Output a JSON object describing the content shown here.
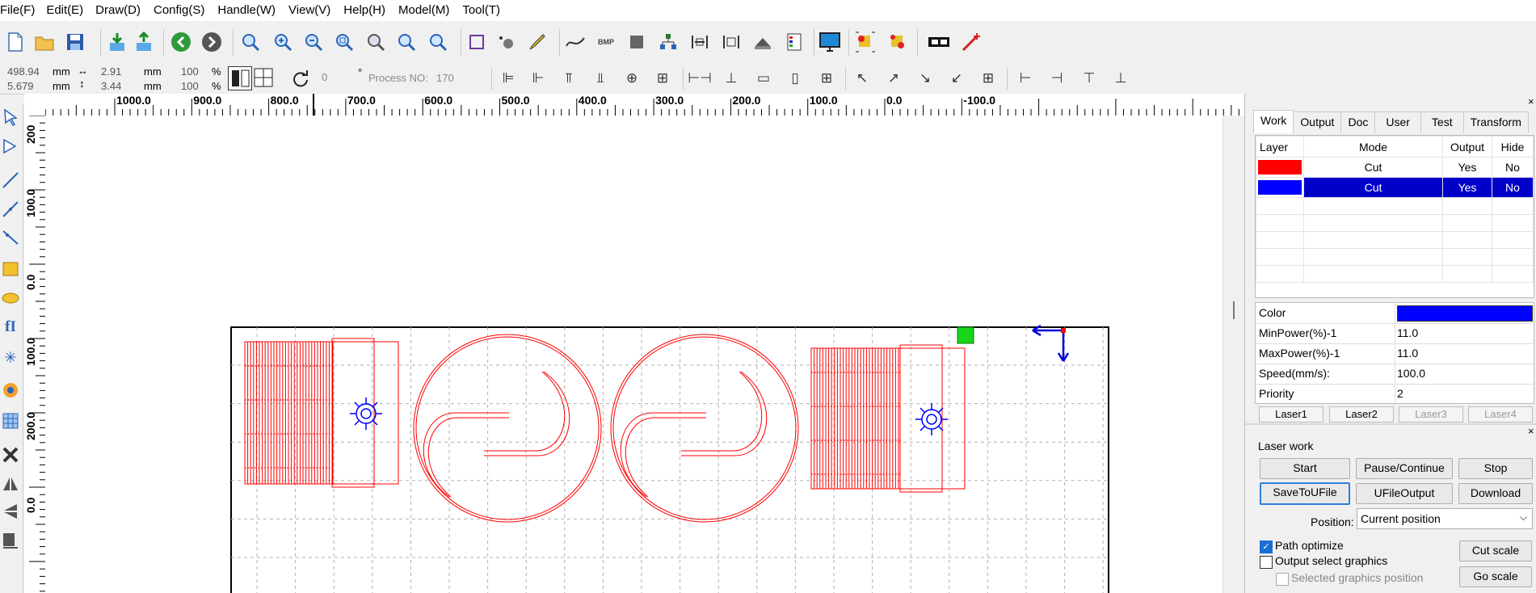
{
  "menu": [
    "File(F)",
    "Edit(E)",
    "Draw(D)",
    "Config(S)",
    "Handle(W)",
    "View(V)",
    "Help(H)",
    "Model(M)",
    "Tool(T)"
  ],
  "toolbar2": {
    "x_value": "498.94",
    "y_value": "5.679",
    "x_unit": "mm",
    "y_unit": "mm",
    "w_value": "2.91",
    "h_value": "3.44",
    "w_unit": "mm",
    "h_unit": "mm",
    "scale_x": "100",
    "scale_y": "100",
    "percent": "%",
    "rotate_value": "0",
    "degree": "°",
    "process_label": "Process NO:",
    "process_value": "170"
  },
  "ruler": {
    "h_labels": [
      "1000.0",
      "900.0",
      "800.0",
      "700.0",
      "600.0",
      "500.0",
      "400.0",
      "300.0",
      "200.0",
      "100.0",
      "0.0",
      "-100.0"
    ],
    "v_labels": [
      "200",
      "100.0",
      "0.0",
      "100.0",
      "200.0",
      "0.0"
    ]
  },
  "panel": {
    "tabs": [
      "Work",
      "Output",
      "Doc",
      "User",
      "Test",
      "Transform"
    ],
    "active_tab": "Work",
    "layer_headers": [
      "Layer",
      "Mode",
      "Output",
      "Hide"
    ],
    "layers": [
      {
        "color": "#ff0000",
        "mode": "Cut",
        "output": "Yes",
        "hide": "No",
        "selected": false
      },
      {
        "color": "#0000ff",
        "mode": "Cut",
        "output": "Yes",
        "hide": "No",
        "selected": true
      }
    ],
    "props": [
      {
        "key": "Color",
        "value": ""
      },
      {
        "key": "MinPower(%)-1",
        "value": "11.0"
      },
      {
        "key": "MaxPower(%)-1",
        "value": "11.0"
      },
      {
        "key": "Speed(mm/s):",
        "value": "100.0"
      },
      {
        "key": "Priority",
        "value": "2"
      }
    ],
    "selected_color": "#0000ff",
    "laser_tabs": [
      "Laser1",
      "Laser2",
      "Laser3",
      "Laser4"
    ],
    "laser_work_title": "Laser work",
    "buttons": {
      "start": "Start",
      "pause": "Pause/Continue",
      "stop": "Stop",
      "save_to_ufile": "SaveToUFile",
      "ufile_output": "UFileOutput",
      "download": "Download",
      "cut_scale": "Cut scale",
      "go_scale": "Go scale"
    },
    "position_label": "Position:",
    "position_value": "Current position",
    "path_optimize": "Path optimize",
    "output_select": "Output select graphics",
    "selected_position": "Selected graphics position"
  },
  "colors": {
    "cut_red": "#ff0000",
    "layer_blue": "#0000ff",
    "selection": "#0000c8"
  }
}
